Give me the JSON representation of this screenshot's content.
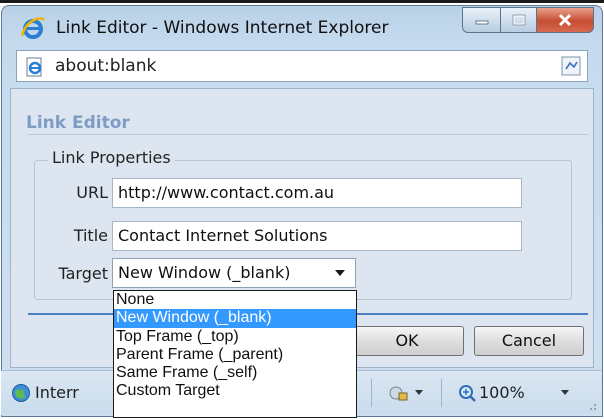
{
  "window": {
    "title": "Link Editor - Windows Internet Explorer",
    "icon": "ie-logo-icon",
    "controls": {
      "minimize": "minimize-icon",
      "maximize": "maximize-icon",
      "close": "close-icon"
    }
  },
  "address": {
    "url": "about:blank",
    "page_icon": "ie-page-icon",
    "compat_icon": "compatibility-view-icon"
  },
  "dialog": {
    "title": "Link Editor",
    "group_label": "Link Properties",
    "url_label": "URL",
    "url_value": "http://www.contact.com.au",
    "title_label": "Title",
    "title_value": "Contact Internet Solutions",
    "target_label": "Target",
    "target_value": "New Window (_blank)",
    "ok_label": "OK",
    "cancel_label": "Cancel"
  },
  "dropdown": {
    "options": [
      {
        "label": "None",
        "selected": false
      },
      {
        "label": "New Window (_blank)",
        "selected": true
      },
      {
        "label": "Top Frame (_top)",
        "selected": false
      },
      {
        "label": "Parent Frame (_parent)",
        "selected": false
      },
      {
        "label": "Same Frame (_self)",
        "selected": false
      },
      {
        "label": "Custom Target",
        "selected": false
      }
    ]
  },
  "statusbar": {
    "zone_text": "Interr",
    "zoom": "100%",
    "icons": [
      "globe-icon",
      "security-zone-icon",
      "zoom-icon"
    ]
  },
  "colors": {
    "selection": "#3399ff",
    "dialog_title": "#7e9cc4",
    "separator": "#4e7fc2",
    "close_button": "#c64d32"
  }
}
